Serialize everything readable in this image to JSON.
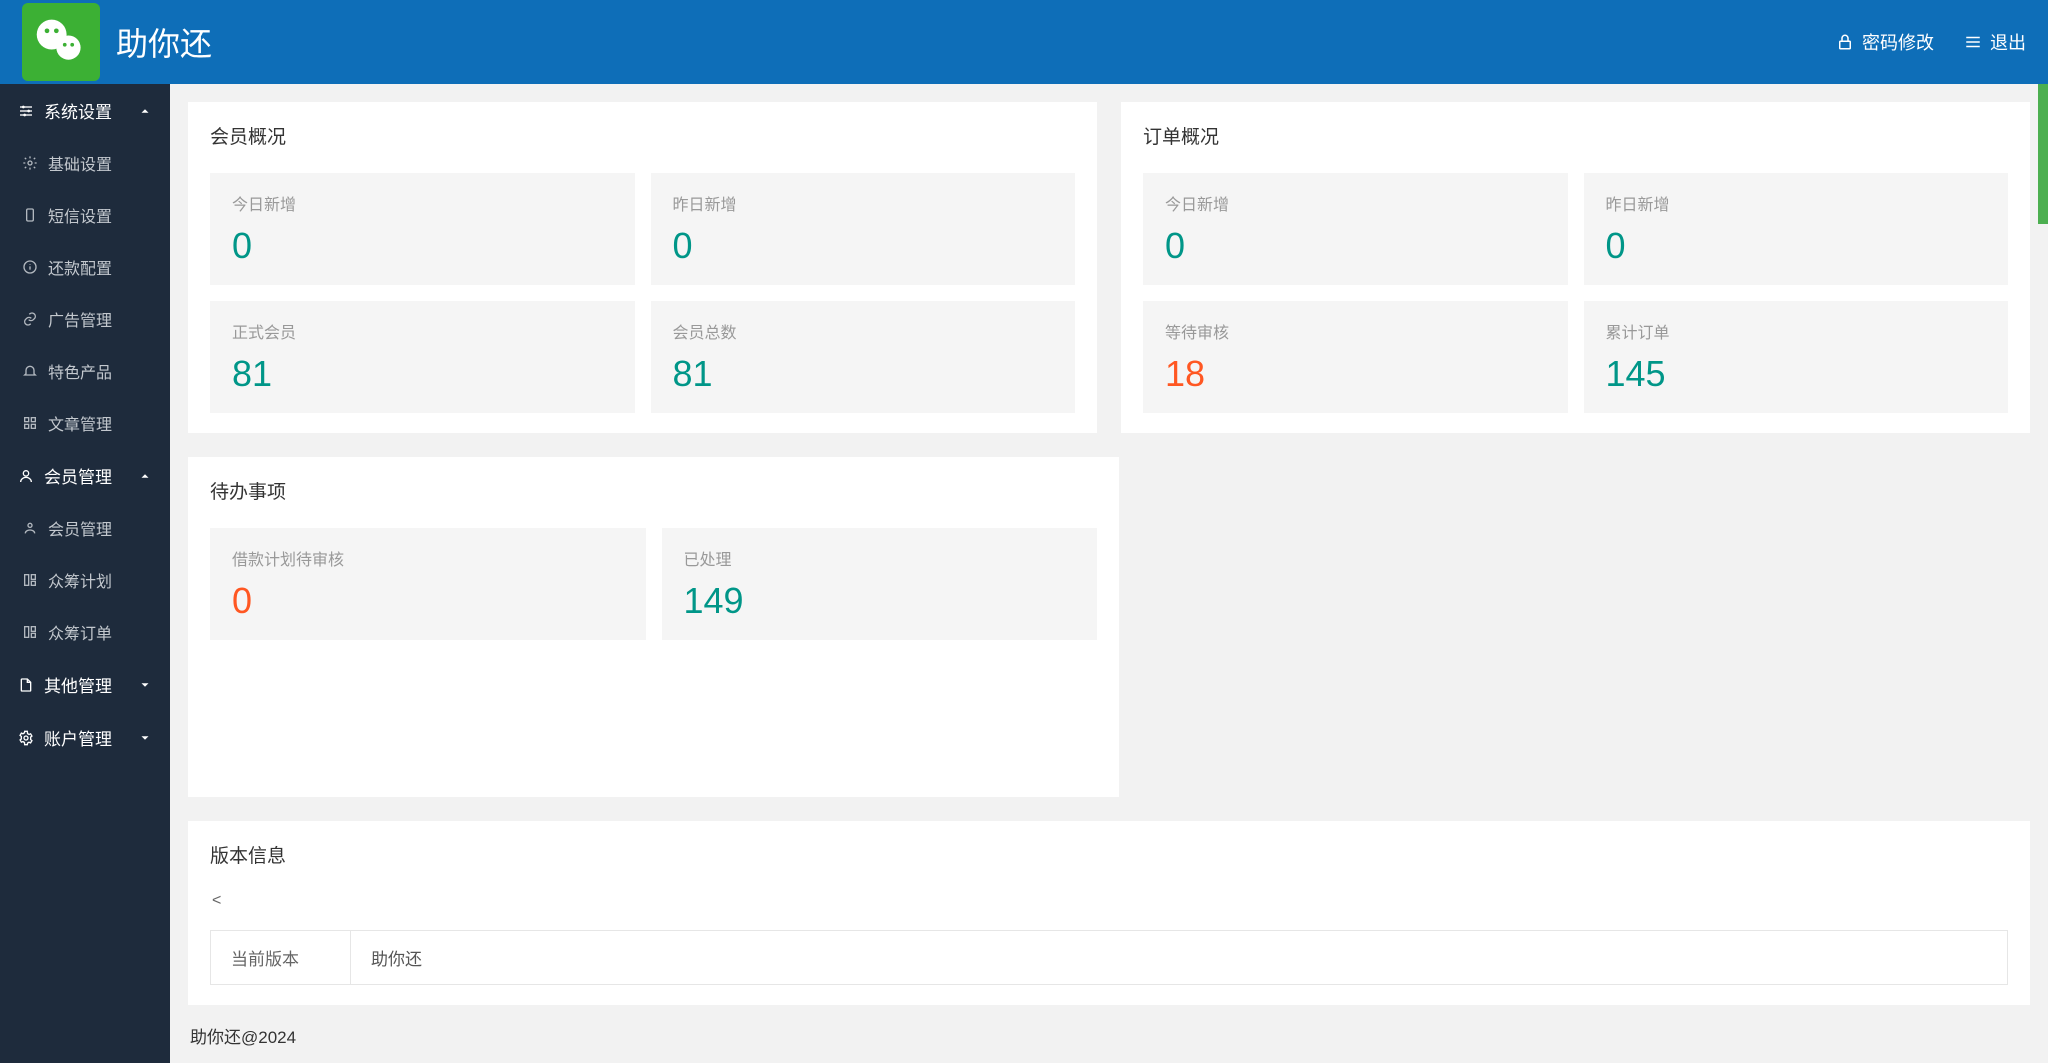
{
  "header": {
    "app_title": "助你还",
    "password_link": "密码修改",
    "logout_link": "退出"
  },
  "sidebar": {
    "groups": [
      {
        "label": "系统设置",
        "expanded": true,
        "items": [
          {
            "label": "基础设置"
          },
          {
            "label": "短信设置"
          },
          {
            "label": "还款配置"
          },
          {
            "label": "广告管理"
          },
          {
            "label": "特色产品"
          },
          {
            "label": "文章管理"
          }
        ]
      },
      {
        "label": "会员管理",
        "expanded": true,
        "items": [
          {
            "label": "会员管理"
          },
          {
            "label": "众筹计划"
          },
          {
            "label": "众筹订单"
          }
        ]
      },
      {
        "label": "其他管理",
        "expanded": false,
        "items": []
      },
      {
        "label": "账户管理",
        "expanded": false,
        "items": []
      }
    ]
  },
  "members": {
    "title": "会员概况",
    "stats": [
      {
        "label": "今日新增",
        "value": "0"
      },
      {
        "label": "昨日新增",
        "value": "0"
      },
      {
        "label": "正式会员",
        "value": "81"
      },
      {
        "label": "会员总数",
        "value": "81"
      }
    ]
  },
  "orders": {
    "title": "订单概况",
    "stats": [
      {
        "label": "今日新增",
        "value": "0"
      },
      {
        "label": "昨日新增",
        "value": "0"
      },
      {
        "label": "等待审核",
        "value": "18",
        "warn": true
      },
      {
        "label": "累计订单",
        "value": "145"
      }
    ]
  },
  "todo": {
    "title": "待办事项",
    "stats": [
      {
        "label": "借款计划待审核",
        "value": "0",
        "warn": true
      },
      {
        "label": "已处理",
        "value": "149"
      }
    ]
  },
  "version": {
    "title": "版本信息",
    "lt": "<",
    "current_label": "当前版本",
    "current_value": "助你还"
  },
  "footer": "助你还@2024"
}
